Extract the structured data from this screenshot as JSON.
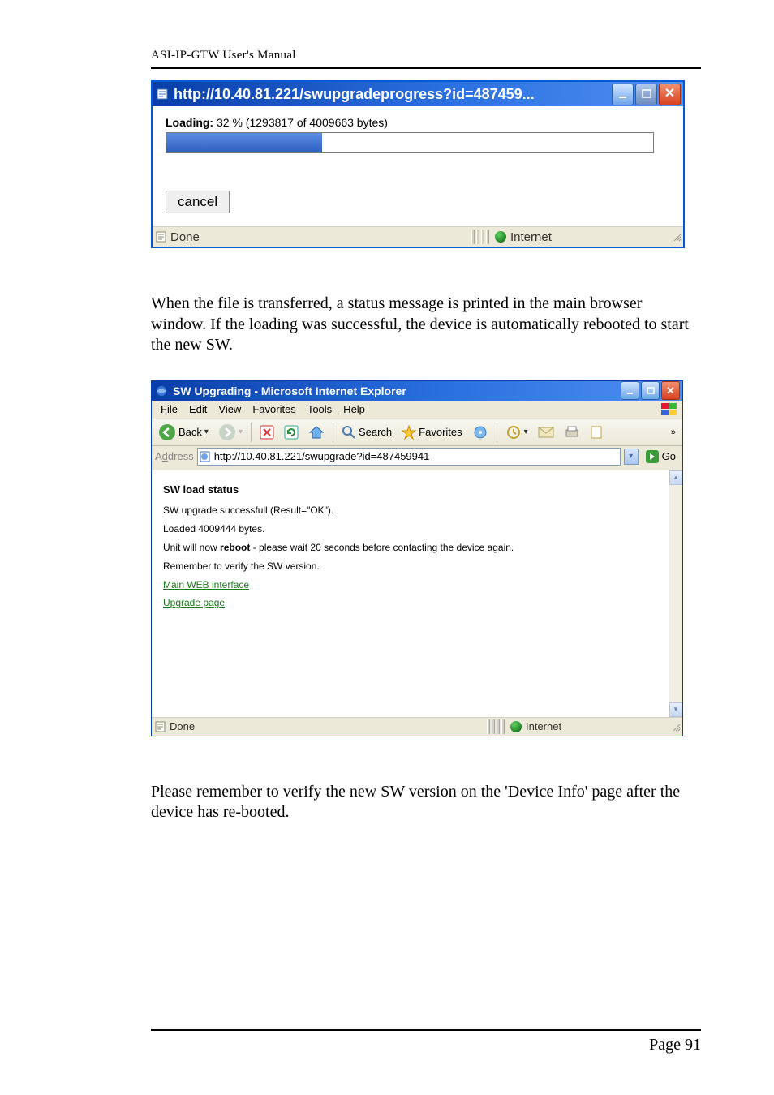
{
  "header": "ASI-IP-GTW User's Manual",
  "footer": "Page 91",
  "paragraph1": "When the file is transferred, a status message is printed in the main browser window. If the loading was successful, the device is automatically rebooted to start the new SW.",
  "paragraph2": "Please remember to verify the new SW version on the 'Device Info' page after the device has re-booted.",
  "progress_window": {
    "title": "http://10.40.81.221/swupgradeprogress?id=487459...",
    "loading_label": "Loading:",
    "loading_text": " 32 % (1293817 of 4009663 bytes)",
    "percent": 32,
    "cancel": "cancel",
    "status_left": "Done",
    "status_right": "Internet"
  },
  "ie_window": {
    "title": "SW Upgrading - Microsoft Internet Explorer",
    "menu": {
      "file": "File",
      "edit": "Edit",
      "view": "View",
      "favorites": "Favorites",
      "tools": "Tools",
      "help": "Help"
    },
    "toolbar": {
      "back": "Back",
      "search": "Search",
      "favorites": "Favorites"
    },
    "address_label": "Address",
    "address_url": "http://10.40.81.221/swupgrade?id=487459941",
    "go": "Go",
    "content": {
      "heading": "SW load status",
      "line1": "SW upgrade successfull (Result=\"OK\").",
      "line2": "Loaded 4009444 bytes.",
      "line3_pre": "Unit will now ",
      "line3_bold": "reboot",
      "line3_post": " - please wait 20 seconds before contacting the device again.",
      "line4": "Remember to verify the SW version.",
      "link1": "Main WEB interface",
      "link2": "Upgrade page"
    },
    "status_left": "Done",
    "status_right": "Internet"
  }
}
